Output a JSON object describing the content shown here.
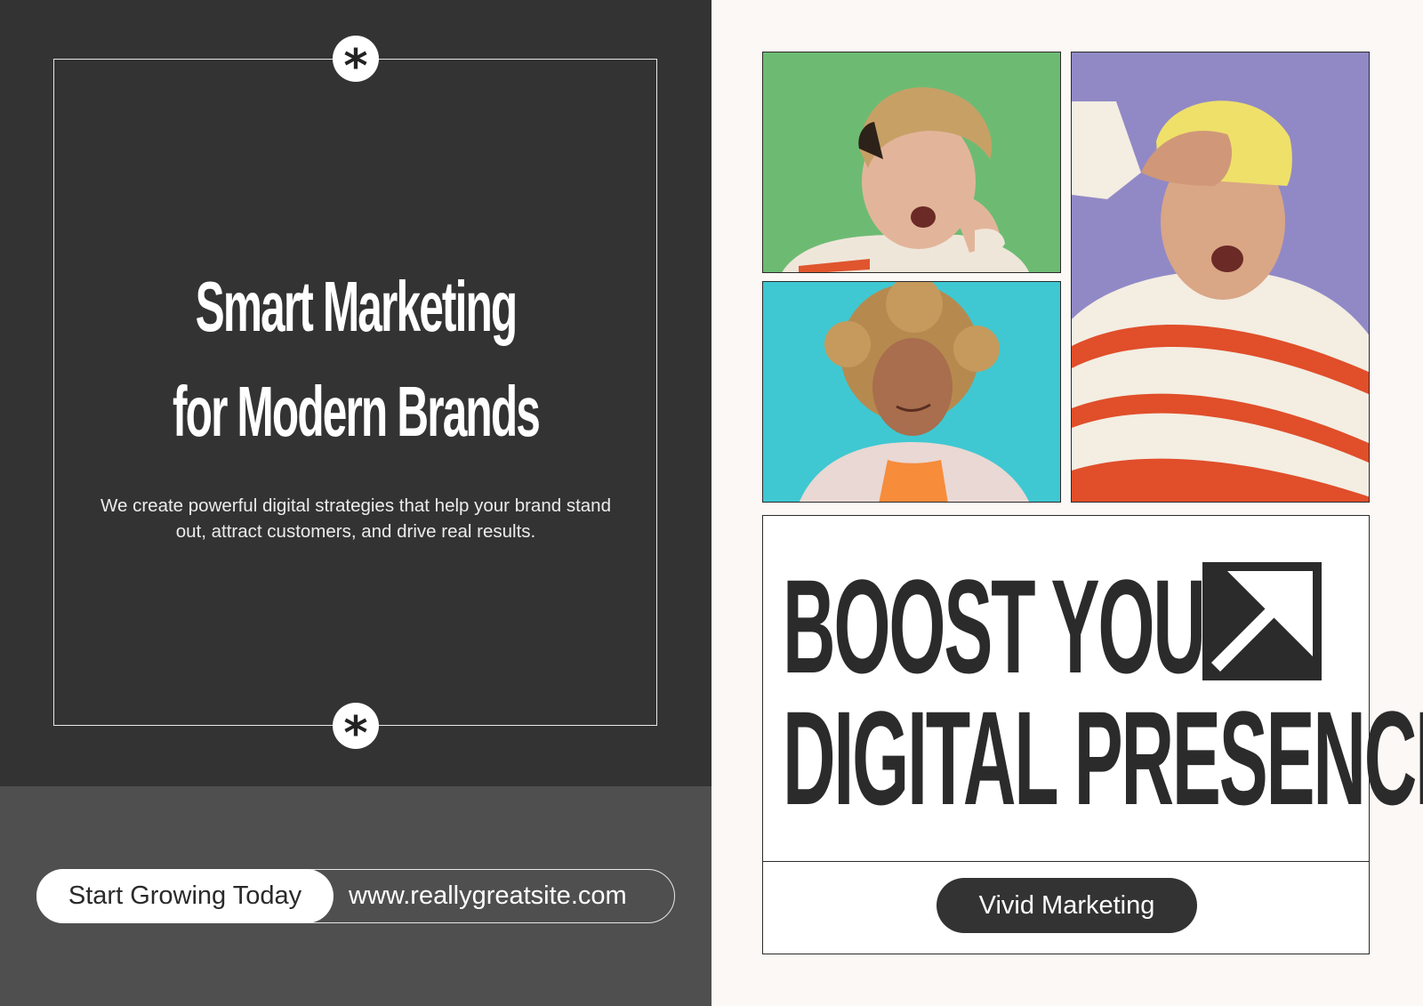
{
  "left_panel": {
    "headline_line1": "Smart Marketing",
    "headline_line2": "for Modern Brands",
    "subtext": "We create powerful digital strategies that help your brand stand out, attract customers, and drive real results.",
    "cta_label": "Start Growing Today",
    "website": "www.reallygreatsite.com",
    "ornament_icon": "asterisk-icon"
  },
  "right_panel": {
    "photos": [
      {
        "name": "photo-person-green",
        "background": "#6dbb73"
      },
      {
        "name": "photo-person-cyan",
        "background": "#3fc8d2"
      },
      {
        "name": "photo-person-purple",
        "background": "#9189c6"
      }
    ],
    "boost_line1": "BOOST YOUR",
    "boost_line2": "DIGITAL PRESENCE",
    "arrow_icon": "arrow-up-right-icon",
    "brand_label": "Vivid Marketing"
  },
  "colors": {
    "dark": "#333333",
    "dark_band": "#4f4f4f",
    "light_bg": "#fcf8f6",
    "text_dark": "#2b2b2b",
    "white": "#ffffff"
  }
}
